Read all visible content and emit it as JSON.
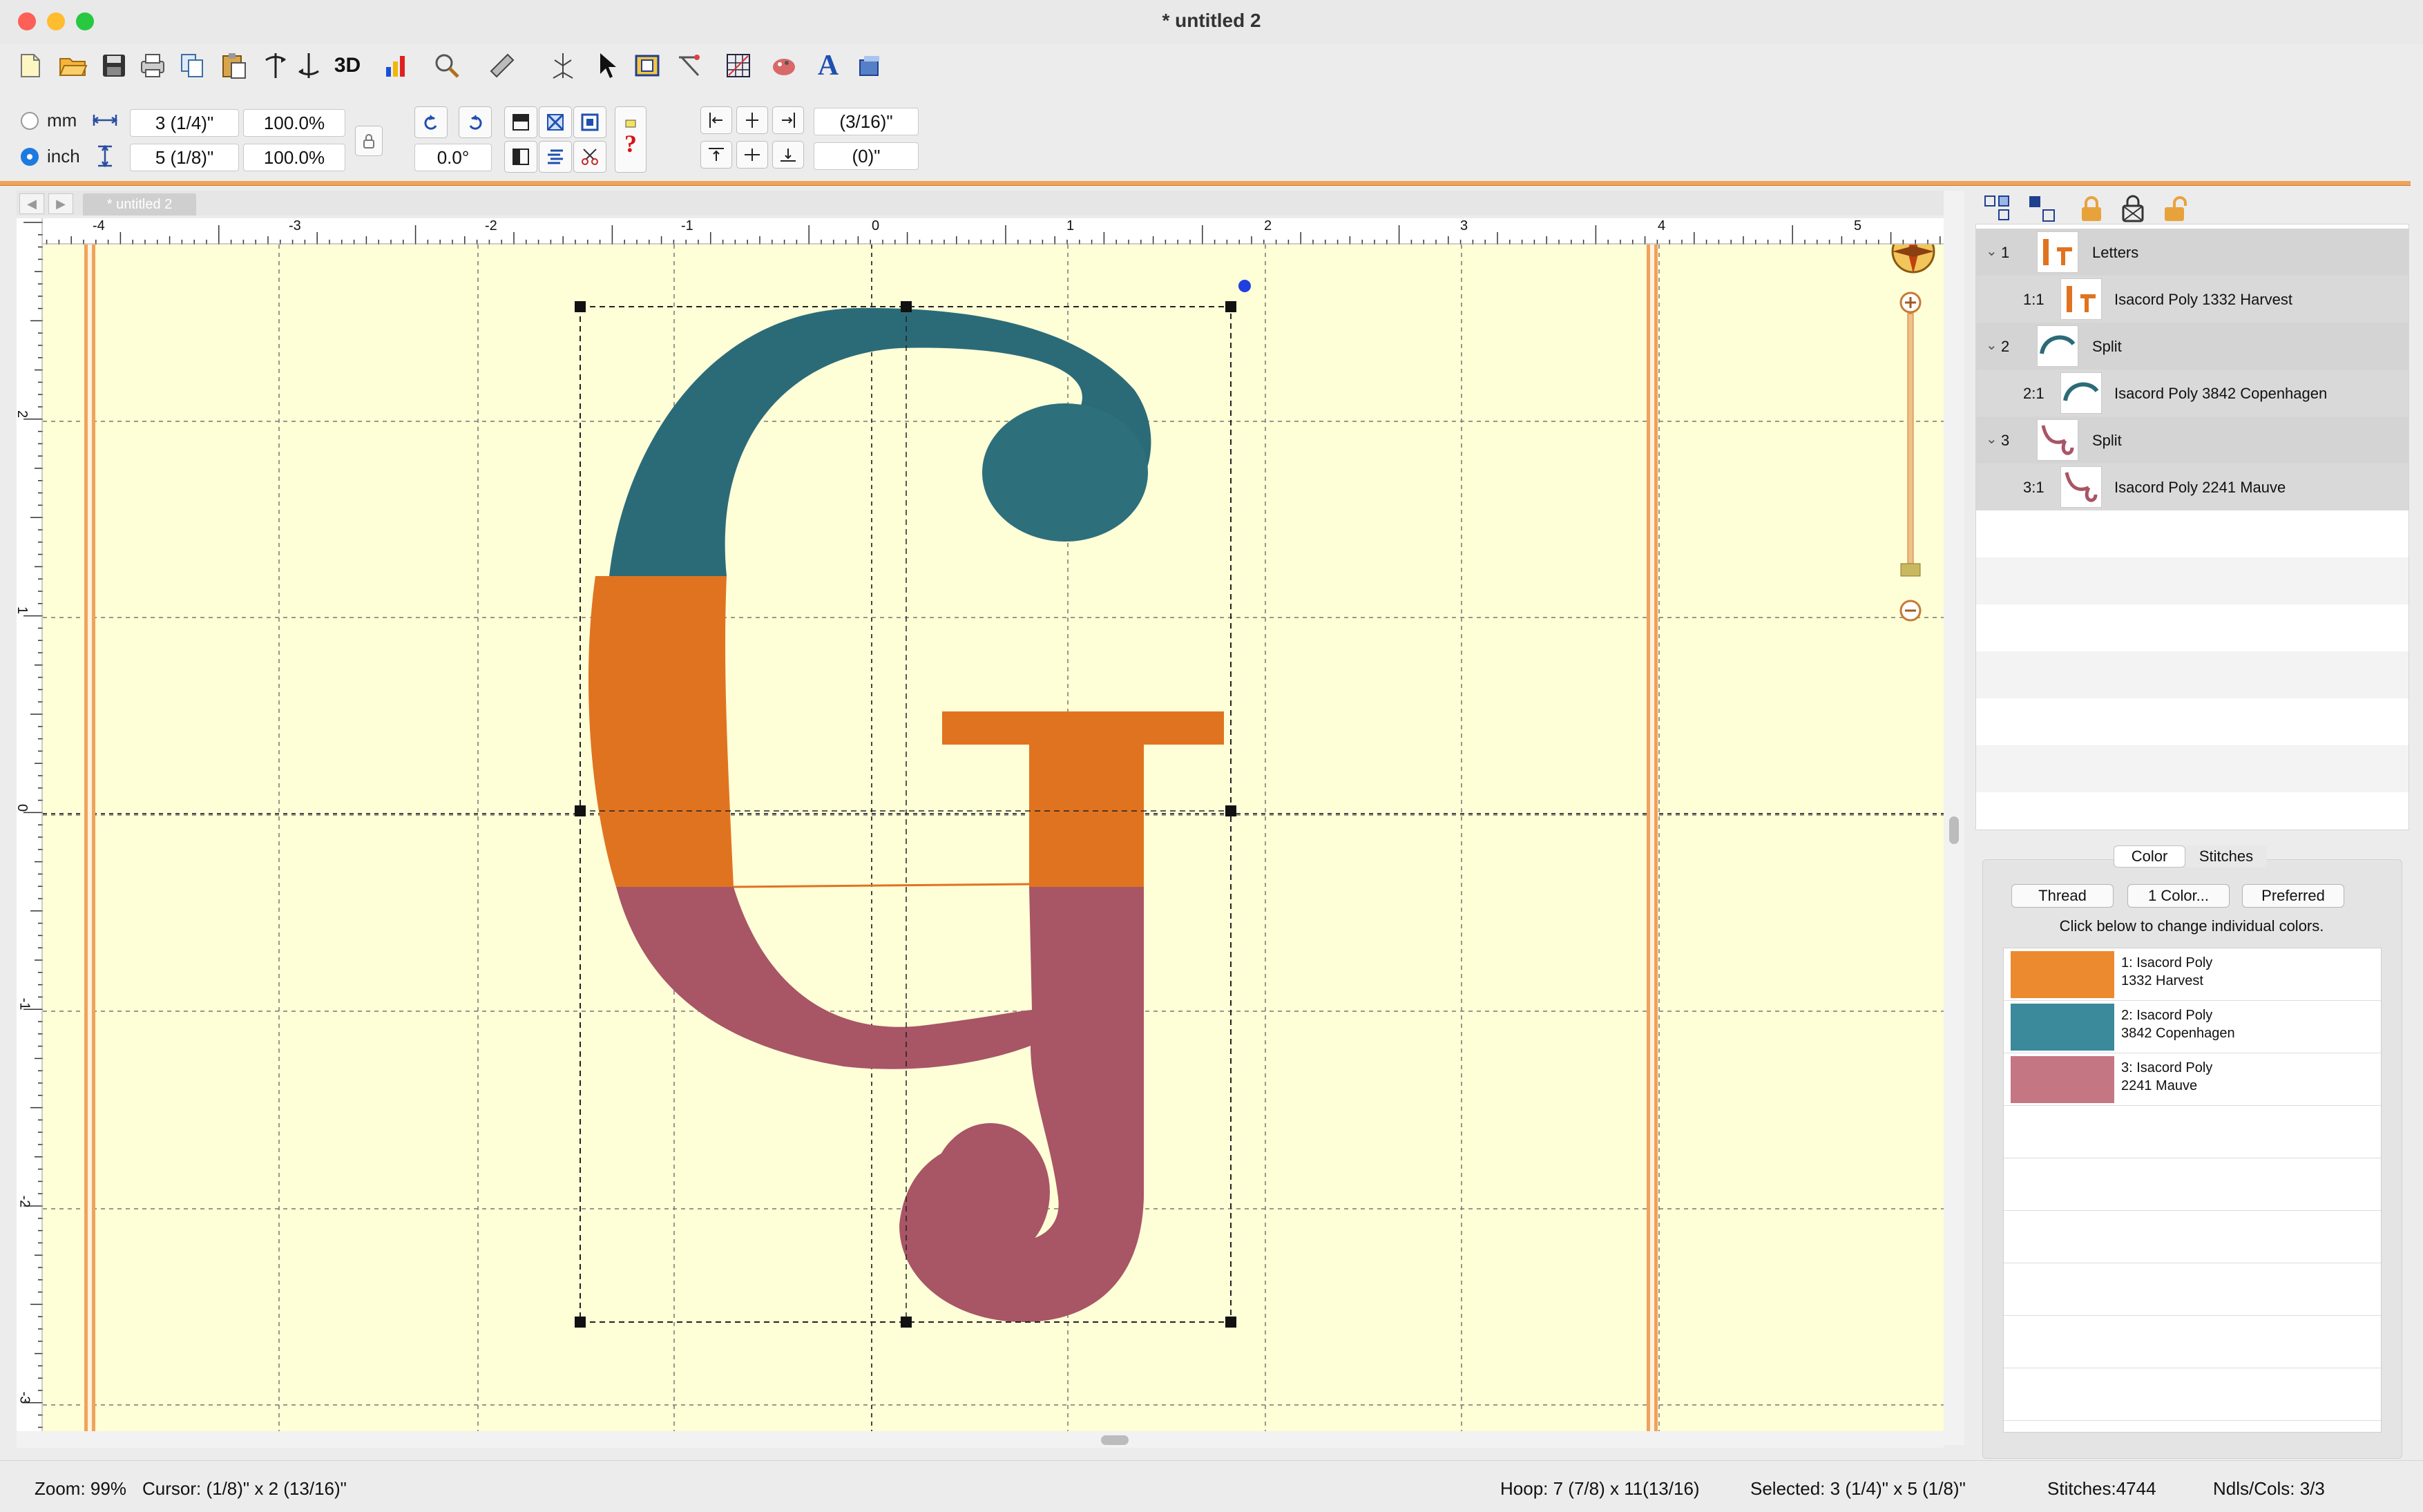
{
  "window": {
    "title": "* untitled 2"
  },
  "toolbar": {
    "icons": [
      "new-file-icon",
      "open-folder-icon",
      "save-icon",
      "print-icon",
      "copy-icon",
      "paste-icon",
      "mirror-horizontal-icon",
      "mirror-vertical-icon",
      "3d-view-icon",
      "chart-icon",
      "magnifier-icon",
      "ruler-icon",
      "stitch-icon",
      "arrow-pointer-icon",
      "hoop-icon",
      "needle-icon",
      "grid-icon",
      "paint-icon",
      "text-icon",
      "settings-icon"
    ],
    "three_d_label": "3D",
    "text_tool_label": "A"
  },
  "properties": {
    "unit_mm": "mm",
    "unit_inch": "inch",
    "selected_unit": "inch",
    "width": "3 (1/4)\"",
    "height": "5 (1/8)\"",
    "width_scale": "100.0%",
    "height_scale": "100.0%",
    "rotation": "0.0°",
    "offset_x": "(3/16)\"",
    "offset_y": "(0)\""
  },
  "canvas": {
    "tab_label": "* untitled 2",
    "ruler_h_labels": [
      "-4",
      "-3",
      "-2",
      "-1",
      "0",
      "1",
      "2",
      "3",
      "4",
      "5"
    ],
    "ruler_v_labels": [
      "2",
      "1",
      "0",
      "-1",
      "-2",
      "-3"
    ],
    "compass_label": "N",
    "letter": "G"
  },
  "objects": {
    "rows": [
      {
        "num": "1",
        "name": "Letters",
        "level": "group"
      },
      {
        "num": "1:1",
        "name": "Isacord Poly 1332 Harvest",
        "level": "child"
      },
      {
        "num": "2",
        "name": "Split",
        "level": "group"
      },
      {
        "num": "2:1",
        "name": "Isacord Poly 3842 Copenhagen",
        "level": "child"
      },
      {
        "num": "3",
        "name": "Split",
        "level": "group"
      },
      {
        "num": "3:1",
        "name": "Isacord Poly 2241 Mauve",
        "level": "child"
      }
    ]
  },
  "color_panel": {
    "tabs": [
      "Color",
      "Stitches"
    ],
    "buttons": {
      "thread": "Thread",
      "one_color": "1 Color...",
      "preferred": "Preferred"
    },
    "instruction": "Click below to change individual colors.",
    "colors": [
      {
        "line1": "1: Isacord Poly",
        "line2": "1332 Harvest",
        "hex": "#ec8a30"
      },
      {
        "line1": "2: Isacord Poly",
        "line2": "3842 Copenhagen",
        "hex": "#3a8a9b"
      },
      {
        "line1": "3: Isacord Poly",
        "line2": "2241 Mauve",
        "hex": "#c47683"
      }
    ]
  },
  "status": {
    "zoom": "Zoom: 99%",
    "cursor": "Cursor: (1/8)\" x 2 (13/16)\"",
    "hoop": "Hoop: 7 (7/8) x 11(13/16)",
    "selected": "Selected: 3 (1/4)\" x 5 (1/8)\"",
    "stitches": "Stitches:4744",
    "ndls": "Ndls/Cols: 3/3"
  },
  "theme": {
    "harvest": "#e07320",
    "copenhagen": "#2b6b78",
    "mauve": "#a85566",
    "canvas_bg": "#fefed7",
    "accent_orange": "#f0a35a"
  }
}
